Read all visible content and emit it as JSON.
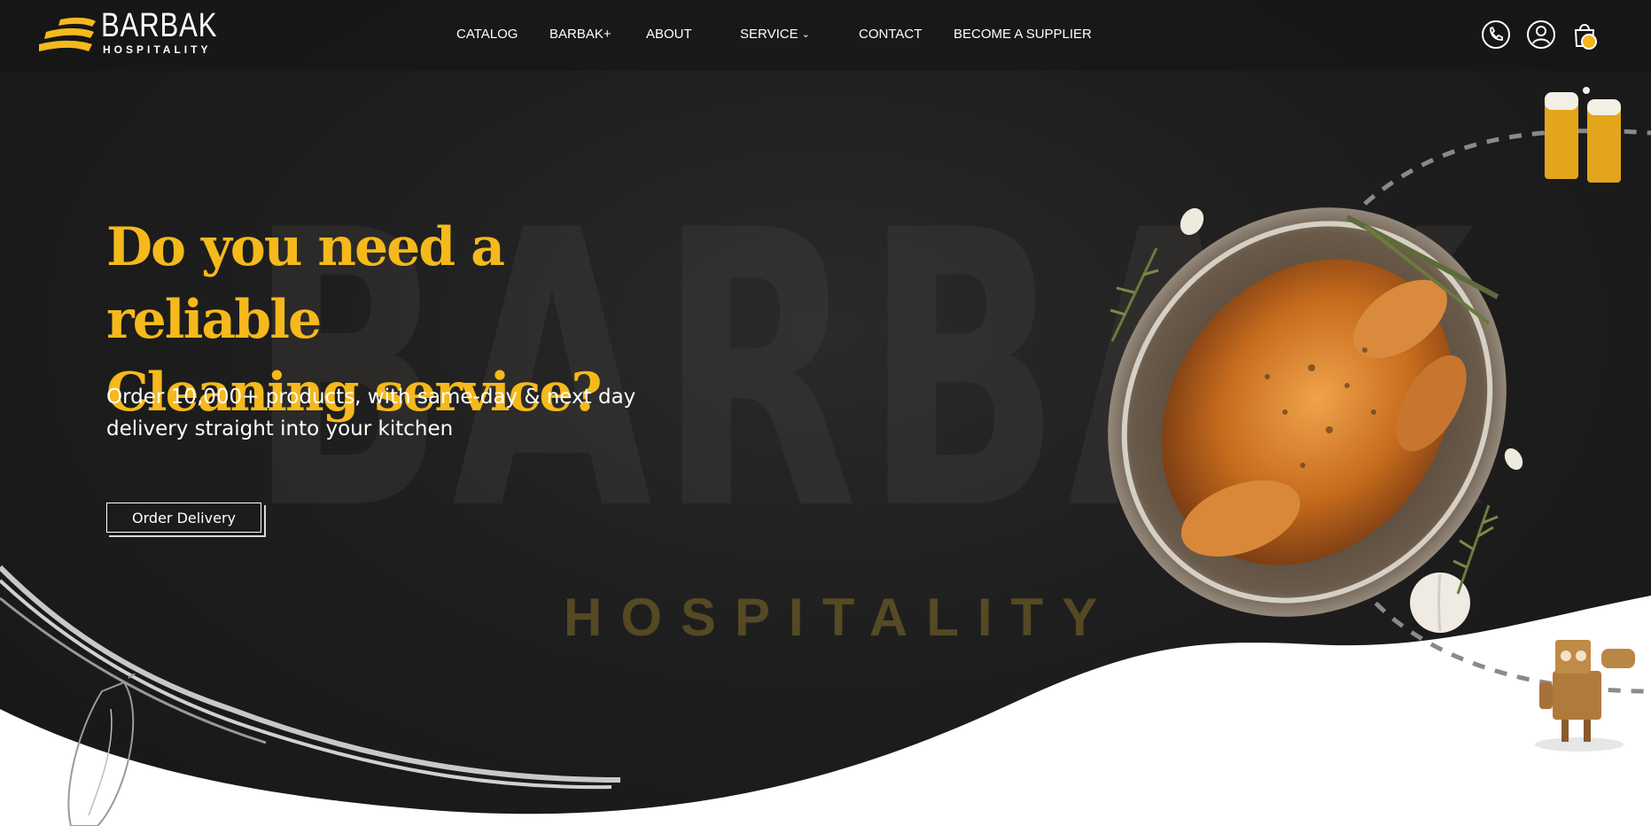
{
  "brand": {
    "name": "BARBAK",
    "tagline": "HOSPITALITY"
  },
  "nav": {
    "items": [
      {
        "label": "CATALOG"
      },
      {
        "label": "BARBAK+"
      },
      {
        "label": "ABOUT"
      },
      {
        "label": "SERVICE",
        "has_dropdown": true
      },
      {
        "label": "CONTACT"
      },
      {
        "label": "BECOME A SUPPLIER"
      }
    ]
  },
  "header_icons": [
    "phone-icon",
    "user-icon",
    "shopping-bag-icon"
  ],
  "hero": {
    "headline_line1": "Do you need a reliable",
    "headline_line2": "Cleaning service?",
    "subtext_line1": "Order 10,000+ products, with same-day & next day",
    "subtext_line2": "delivery straight into your kitchen",
    "cta_label": "Order Delivery",
    "watermark_word": "BARBAK",
    "watermark_sub": "HOSPITALITY"
  },
  "colors": {
    "accent": "#f5b91c",
    "background": "#1c1c1c",
    "text": "#ffffff"
  }
}
